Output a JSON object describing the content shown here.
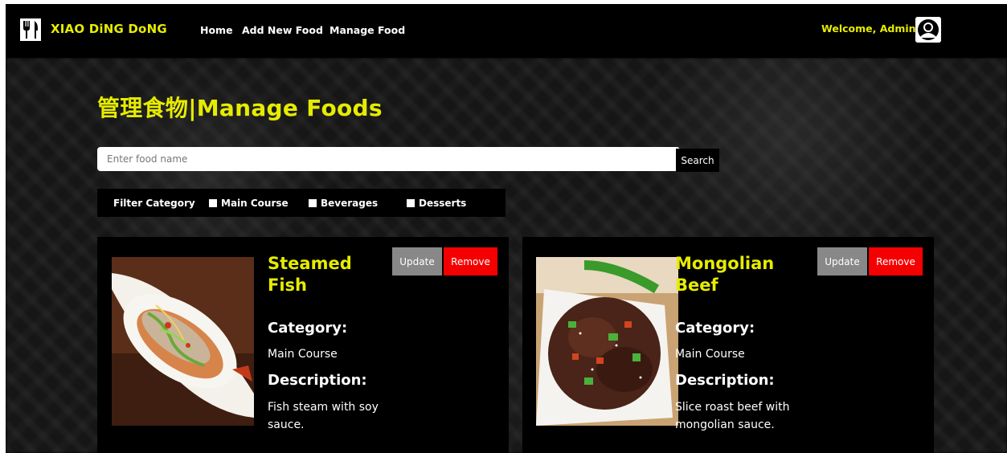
{
  "navbar": {
    "brand": "XIAO DiNG DoNG",
    "links": [
      "Home",
      "Add New Food",
      "Manage Food"
    ],
    "welcome": "Welcome, Admin"
  },
  "page": {
    "title": "管理食物|Manage Foods"
  },
  "search": {
    "placeholder": "Enter food name",
    "value": "",
    "button_label": "Search"
  },
  "filter": {
    "label": "Filter Category",
    "options": [
      "Main Course",
      "Beverages",
      "Desserts"
    ]
  },
  "labels": {
    "update": "Update",
    "remove": "Remove",
    "category": "Category:",
    "description": "Description:"
  },
  "foods": [
    {
      "name": "Steamed Fish",
      "category": "Main Course",
      "description": "Fish steam with soy sauce."
    },
    {
      "name": "Mongolian Beef",
      "category": "Main Course",
      "description": "Slice roast beef with mongolian sauce."
    }
  ],
  "colors": {
    "accent_yellow": "#e6ec00",
    "remove_red": "#f50000",
    "update_grey": "#888888",
    "background": "#000000"
  },
  "icons": [
    "utensils-icon",
    "user-avatar-icon"
  ]
}
